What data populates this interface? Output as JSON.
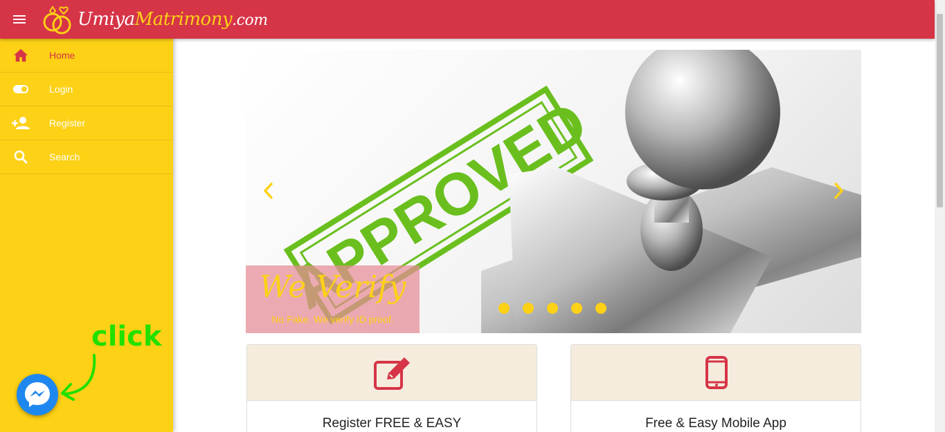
{
  "header": {
    "logo_text_main": "Umiya",
    "logo_text_accent": "Matrimony",
    "logo_text_tld": ".com"
  },
  "sidebar": {
    "items": [
      {
        "label": "Home",
        "icon": "home-icon",
        "active": true
      },
      {
        "label": "Login",
        "icon": "toggle-icon",
        "active": false
      },
      {
        "label": "Register",
        "icon": "person-add-icon",
        "active": false
      },
      {
        "label": "Search",
        "icon": "search-icon",
        "active": false
      }
    ]
  },
  "carousel": {
    "stamp_text": "APPROVED",
    "overlay_title": "We Verify",
    "overlay_subtitle": "No Fake. We verify ID proof.",
    "slide_count": 5,
    "active_slide": 4
  },
  "cards": [
    {
      "title": "Register FREE & EASY",
      "icon": "edit-icon"
    },
    {
      "title": "Free & Easy Mobile App",
      "icon": "mobile-phone-icon"
    }
  ],
  "annotation": {
    "text": "click"
  },
  "colors": {
    "header": "#d63447",
    "sidebar": "#fdd116",
    "accent_red": "#d63447",
    "messenger": "#1e88f0",
    "annotation_green": "#22e000"
  }
}
